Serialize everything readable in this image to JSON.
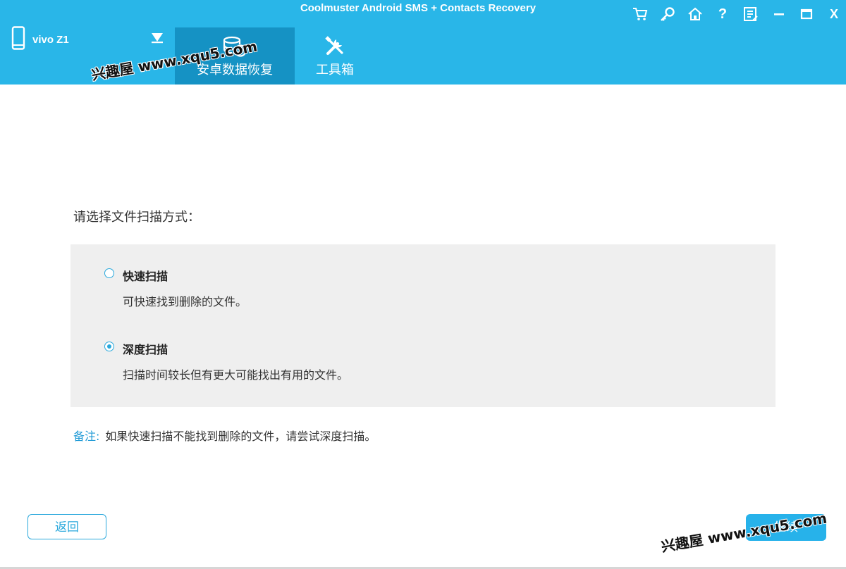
{
  "app": {
    "title": "Coolmuster Android SMS + Contacts Recovery"
  },
  "device": {
    "name": "vivo Z1",
    "icon": "phone-icon",
    "dropdown_icon": "triangle-down-icon"
  },
  "tabs": [
    {
      "label": "安卓数据恢复",
      "icon": "database-recovery-icon",
      "active": true
    },
    {
      "label": "工具箱",
      "icon": "tools-icon",
      "active": false
    }
  ],
  "window_controls": [
    "cart-icon",
    "key-icon",
    "home-icon",
    "help-icon",
    "feedback-icon",
    "minimize-icon",
    "maximize-icon",
    "close-icon"
  ],
  "window_text": {
    "help": "?",
    "close": "X"
  },
  "main": {
    "prompt": "请选择文件扫描方式：",
    "options": [
      {
        "title": "快速扫描",
        "description": "可快速找到删除的文件。",
        "selected": false
      },
      {
        "title": "深度扫描",
        "description": "扫描时间较长但有更大可能找出有用的文件。",
        "selected": true
      }
    ],
    "note_label": "备注:",
    "note_text": "如果快速扫描不能找到删除的文件，请尝试深度扫描。"
  },
  "buttons": {
    "back": "返回",
    "continue": "继续"
  },
  "watermark": "兴趣屋 www.xqu5.com",
  "colors": {
    "header": "#29b6e8",
    "active_tab": "#1592c4",
    "accent": "#29a8dc",
    "panel": "#efefef"
  }
}
